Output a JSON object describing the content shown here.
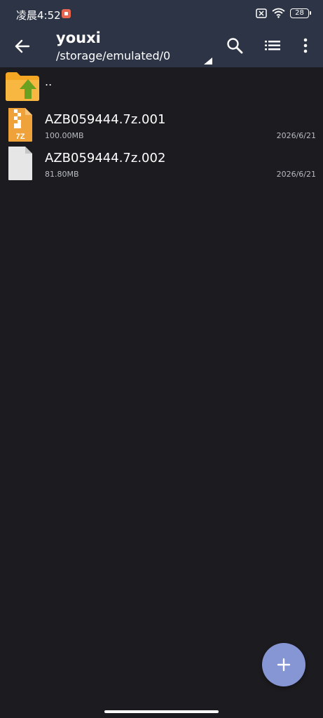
{
  "status_bar": {
    "time": "凌晨4:52",
    "battery_level": "28"
  },
  "toolbar": {
    "title": "youxi",
    "path": "/storage/emulated/0"
  },
  "parent_entry": {
    "name": ".."
  },
  "files": [
    {
      "name": "AZB059444.7z.001",
      "size": "100.00MB",
      "date": "2026/6/21",
      "icon": "7z-archive-icon",
      "icon_label": "7Z"
    },
    {
      "name": "AZB059444.7z.002",
      "size": "81.80MB",
      "date": "2026/6/21",
      "icon": "generic-file-icon"
    }
  ],
  "colors": {
    "background": "#1c1b1f",
    "toolbar": "#2c3445",
    "folder": "#f5a623",
    "up_arrow": "#6aa121",
    "archive": "#f0a23a",
    "generic_file": "#e6e6e6",
    "fab": "#8695d4",
    "app_badge": "#e8664f"
  }
}
